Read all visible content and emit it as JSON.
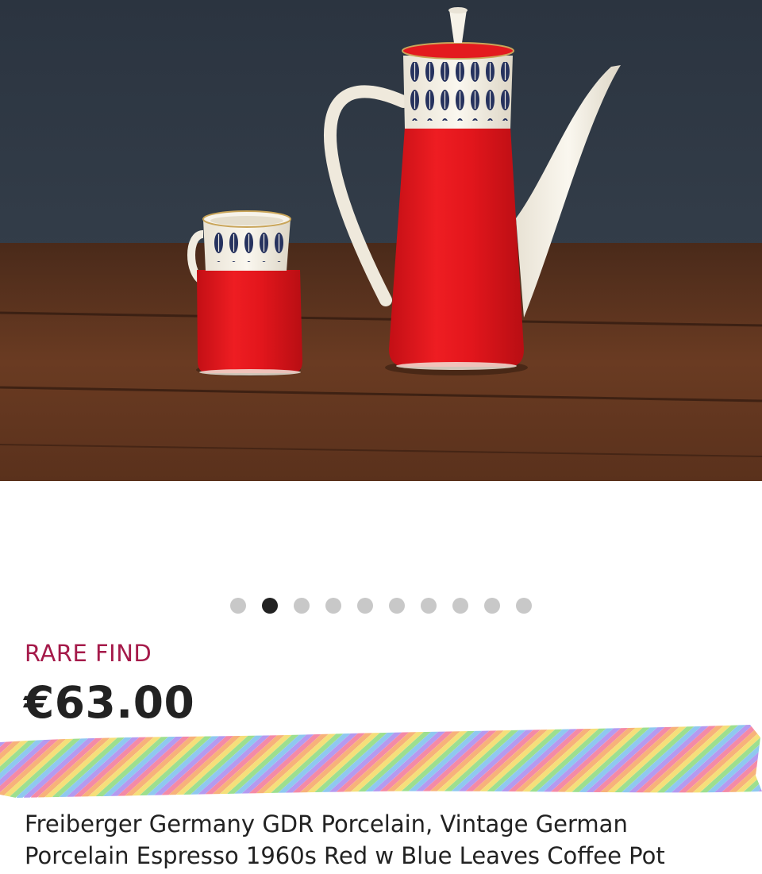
{
  "listing": {
    "badge": "RARE FIND",
    "price": "€63.00",
    "title_line1": "Freiberger Germany GDR Porcelain, Vintage German",
    "title_line2": "Porcelain Espresso 1960s Red w Blue Leaves Coffee Pot"
  },
  "carousel": {
    "total_images": 10,
    "active_index": 1
  },
  "colors": {
    "badge": "#a51a4a",
    "text": "#222222",
    "dot_active": "#222222",
    "dot_inactive": "#c8c8c8",
    "porcelain_red": "#e3161c",
    "pattern_blue": "#26325e"
  }
}
